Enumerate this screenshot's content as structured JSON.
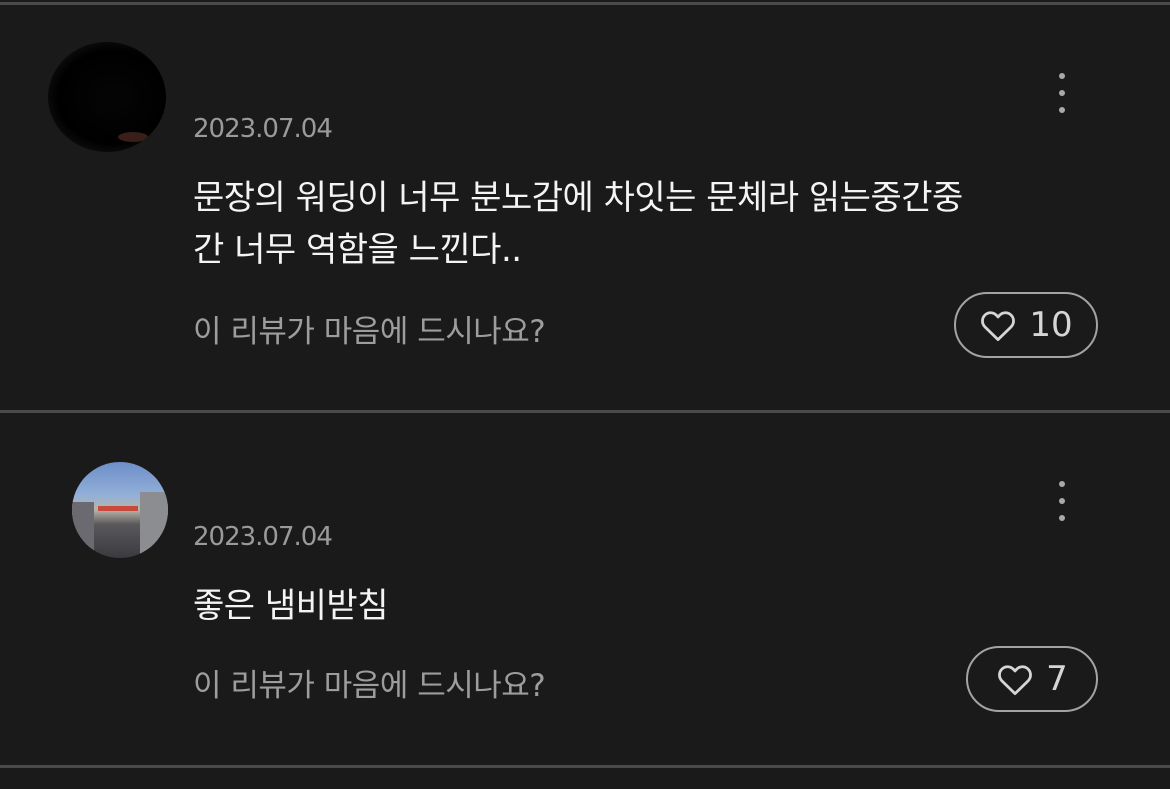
{
  "reviews": [
    {
      "username": "ㅤㅤㅤ",
      "date": "2023.07.04",
      "text_line1": "문장의 워딩이 너무 분노감에 차잇는 문체라 읽는중간중",
      "text_line2": "간 너무 역함을 느낀다..",
      "prompt": "이 리뷰가 마음에 드시나요?",
      "like_count": "10",
      "avatar": "avatar-obscured"
    },
    {
      "username": "ㅤㅤㅤ",
      "date": "2023.07.04",
      "text_line1": "좋은 냄비받침",
      "text_line2": "",
      "prompt": "이 리뷰가 마음에 드시나요?",
      "like_count": "7",
      "avatar": "avatar-street-photo"
    }
  ],
  "icons": {
    "more": "more-vertical-icon",
    "like": "heart-outline-icon"
  },
  "colors": {
    "background": "#1a1a1b",
    "divider": "#4a4a4c",
    "text_primary": "#f4f4f4",
    "text_secondary": "#9a9a9c"
  }
}
